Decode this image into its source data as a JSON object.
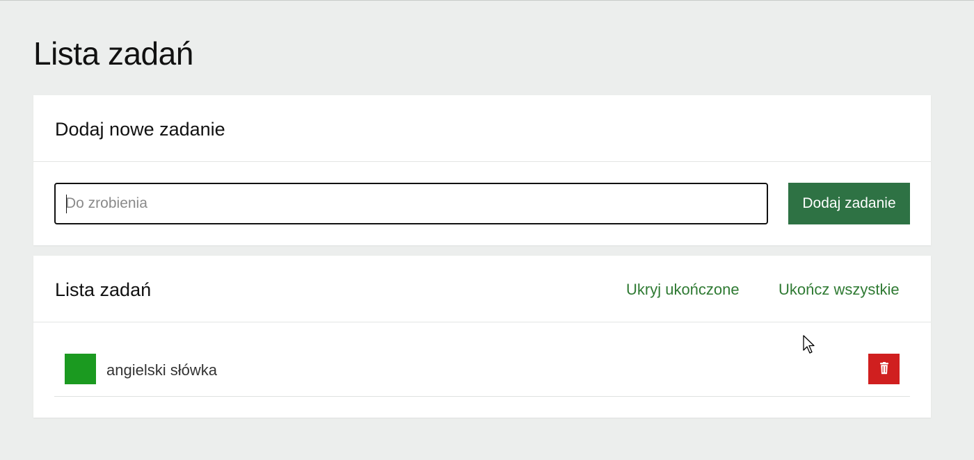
{
  "page": {
    "title": "Lista zadań"
  },
  "add_card": {
    "title": "Dodaj nowe zadanie",
    "input_placeholder": "Do zrobienia",
    "input_value": "",
    "button_label": "Dodaj zadanie"
  },
  "list_card": {
    "title": "Lista zadań",
    "hide_completed_label": "Ukryj ukończone",
    "complete_all_label": "Ukończ wszystkie",
    "tasks": [
      {
        "label": "angielski słówka",
        "completed": true
      }
    ]
  },
  "colors": {
    "background": "#eceeed",
    "primary_button": "#2e7244",
    "link": "#2f7a33",
    "checkbox_done": "#1b9a20",
    "delete_button": "#d01f1f"
  },
  "icons": {
    "delete": "trash-icon",
    "cursor": "mouse-pointer-icon"
  }
}
